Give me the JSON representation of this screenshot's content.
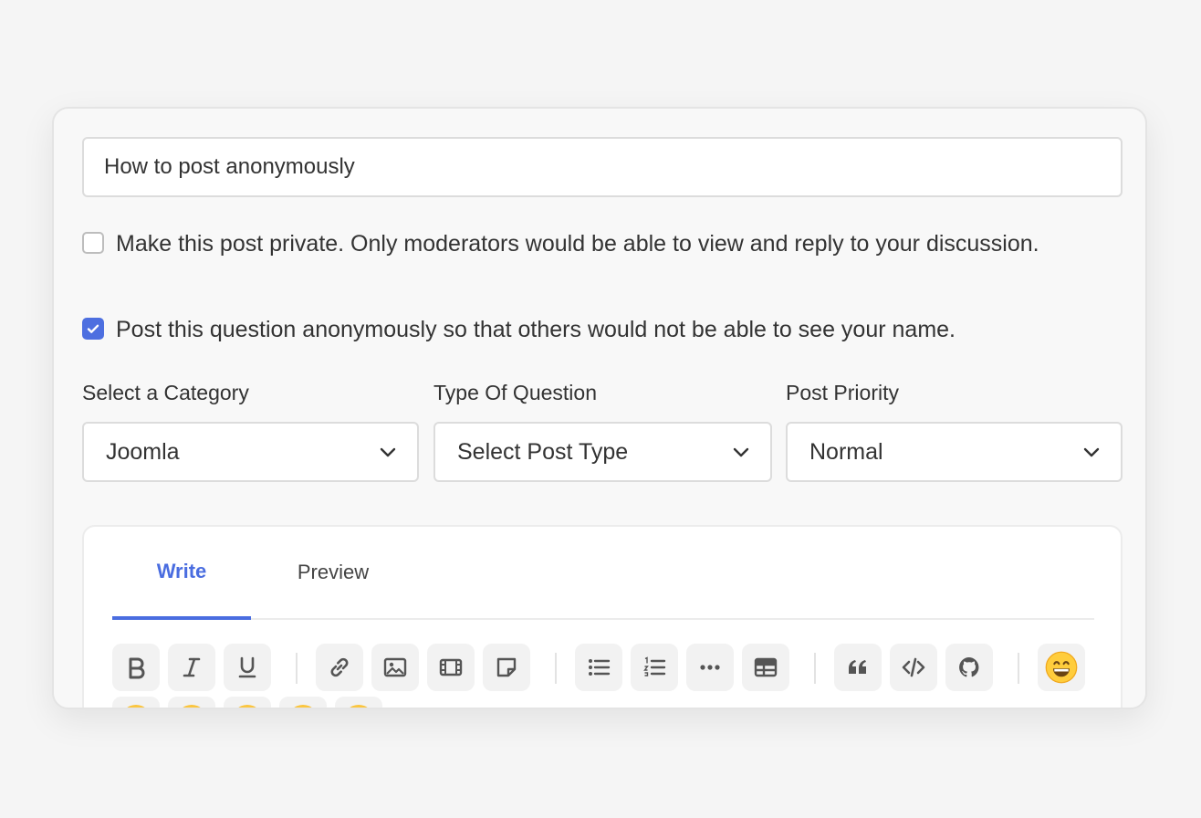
{
  "title_field": {
    "value": "How to post anonymously"
  },
  "options": {
    "private": {
      "label": "Make this post private. Only moderators would be able to view and reply to your discussion.",
      "checked": false
    },
    "anonymous": {
      "label": "Post this question anonymously so that others would not be able to see your name.",
      "checked": true
    }
  },
  "fields": {
    "category": {
      "label": "Select a Category",
      "value": "Joomla"
    },
    "post_type": {
      "label": "Type Of Question",
      "value": "Select Post Type"
    },
    "priority": {
      "label": "Post Priority",
      "value": "Normal"
    }
  },
  "editor": {
    "tabs": [
      {
        "label": "Write",
        "active": true
      },
      {
        "label": "Preview",
        "active": false
      }
    ],
    "toolbar_icons": [
      "bold-icon",
      "italic-icon",
      "underline-icon",
      "link-icon",
      "image-icon",
      "video-icon",
      "note-icon",
      "bullet-list-icon",
      "numbered-list-icon",
      "more-icon",
      "table-icon",
      "quote-icon",
      "code-icon",
      "github-icon",
      "emoji-icon"
    ]
  },
  "colors": {
    "accent": "#4d6fe0",
    "card_bg": "#f8f8f8",
    "border": "#dcdcdc"
  }
}
